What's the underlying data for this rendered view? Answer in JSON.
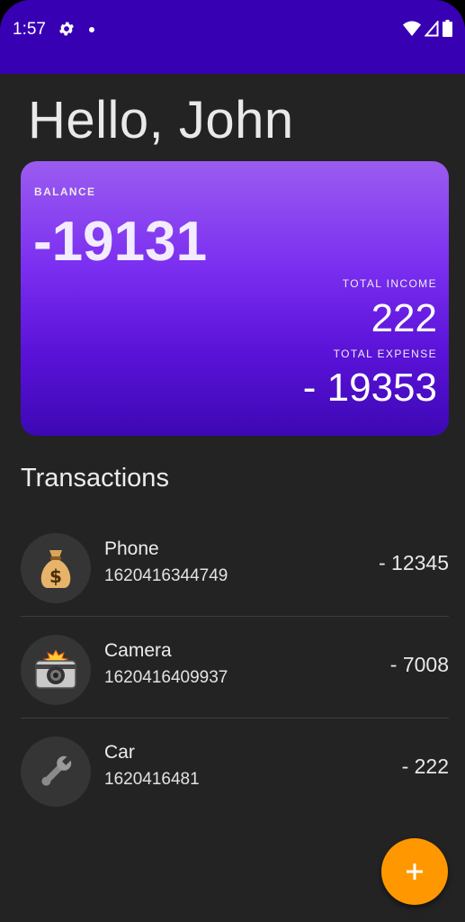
{
  "status_bar": {
    "time": "1:57",
    "color": "#3700b3",
    "icons": [
      "gear-icon",
      "notification-dot-icon",
      "wifi-icon",
      "signal-icon",
      "battery-icon"
    ]
  },
  "greeting": "Hello, John",
  "balance_card": {
    "balance_label": "BALANCE",
    "balance_value": "-19131",
    "income_label": "TOTAL INCOME",
    "income_value": "222",
    "expense_label": "TOTAL EXPENSE",
    "expense_value": "- 19353"
  },
  "transactions": {
    "title": "Transactions",
    "items": [
      {
        "name": "Phone",
        "time": "1620416344749",
        "amount": "- 12345",
        "icon": "money-bag-icon"
      },
      {
        "name": "Camera",
        "time": "1620416409937",
        "amount": "- 7008",
        "icon": "camera-flash-icon"
      },
      {
        "name": "Car",
        "time": "1620416481",
        "amount": "- 222",
        "icon": "wrench-icon"
      }
    ]
  },
  "fab": {
    "icon": "plus-icon",
    "color": "#ff9800"
  }
}
